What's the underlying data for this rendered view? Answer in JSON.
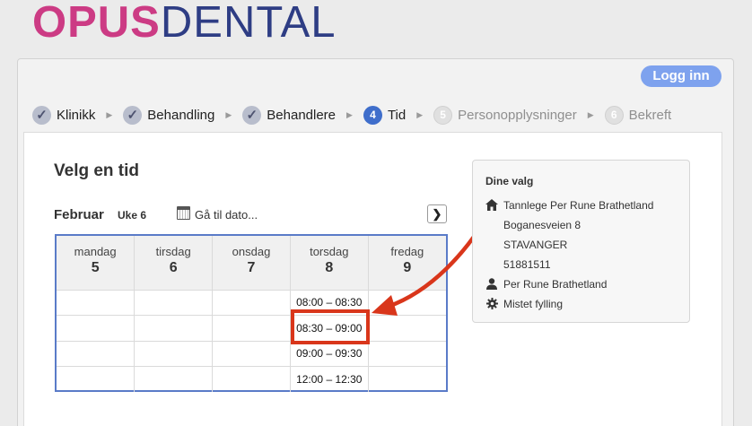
{
  "logo": {
    "part1": "OPUS",
    "part2": "DENTAL"
  },
  "header": {
    "login_label": "Logg inn"
  },
  "steps": [
    {
      "label": "Klinikk",
      "state": "done",
      "marker": "✓"
    },
    {
      "label": "Behandling",
      "state": "done",
      "marker": "✓"
    },
    {
      "label": "Behandlere",
      "state": "done",
      "marker": "✓"
    },
    {
      "label": "Tid",
      "state": "current",
      "marker": "4"
    },
    {
      "label": "Personopplysninger",
      "state": "todo",
      "marker": "5"
    },
    {
      "label": "Bekreft",
      "state": "todo",
      "marker": "6"
    }
  ],
  "main": {
    "title": "Velg en tid",
    "month": "Februar",
    "week": "Uke 6",
    "goto_date": "Gå til dato...",
    "next_icon": "chevron-right-icon"
  },
  "calendar": {
    "days": [
      {
        "name": "mandag",
        "num": "5"
      },
      {
        "name": "tirsdag",
        "num": "6"
      },
      {
        "name": "onsdag",
        "num": "7"
      },
      {
        "name": "torsdag",
        "num": "8"
      },
      {
        "name": "fredag",
        "num": "9"
      }
    ],
    "slots": [
      [
        "",
        "",
        "",
        "08:00 – 08:30",
        ""
      ],
      [
        "",
        "",
        "",
        "08:30 – 09:00",
        ""
      ],
      [
        "",
        "",
        "",
        "09:00 – 09:30",
        ""
      ],
      [
        "",
        "",
        "",
        "12:00 – 12:30",
        ""
      ]
    ],
    "highlighted_slot": "08:30 – 09:00"
  },
  "choices": {
    "title": "Dine valg",
    "clinic_name": "Tannlege Per Rune Brathetland",
    "address": "Boganesveien 8",
    "city": "STAVANGER",
    "phone": "51881511",
    "practitioner": "Per Rune Brathetland",
    "treatment": "Mistet fylling"
  },
  "colors": {
    "accent": "#3f6ecb",
    "login": "#7ea2ee",
    "logo_pink": "#cc3b84",
    "logo_navy": "#2e3d84",
    "highlight": "#d9361b"
  }
}
